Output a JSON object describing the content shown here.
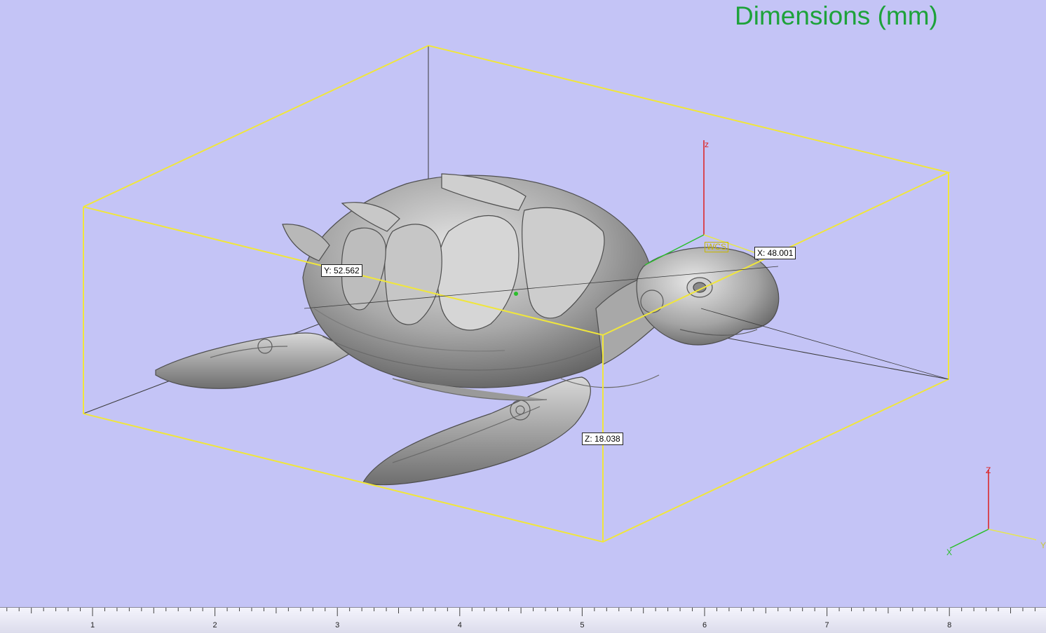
{
  "viewport": {
    "title": "Dimensions (mm)",
    "dimensions": {
      "x_label": "X: 48.001",
      "y_label": "Y: 52.562",
      "z_label": "Z: 18.038"
    },
    "wcs_label": "WCS",
    "model_axis_z": "z",
    "triad": {
      "z": "Z",
      "x": "X",
      "y": "Y"
    }
  },
  "ruler": {
    "labels": [
      "1",
      "2",
      "3",
      "4",
      "5",
      "6",
      "7",
      "8"
    ]
  },
  "colors": {
    "background": "#c4c4f6",
    "bounding_box": "#f0e63c",
    "title": "#1da23a",
    "axis_x": "#2bbf2b",
    "axis_y": "#e6e650",
    "axis_z": "#dd1f1f"
  }
}
